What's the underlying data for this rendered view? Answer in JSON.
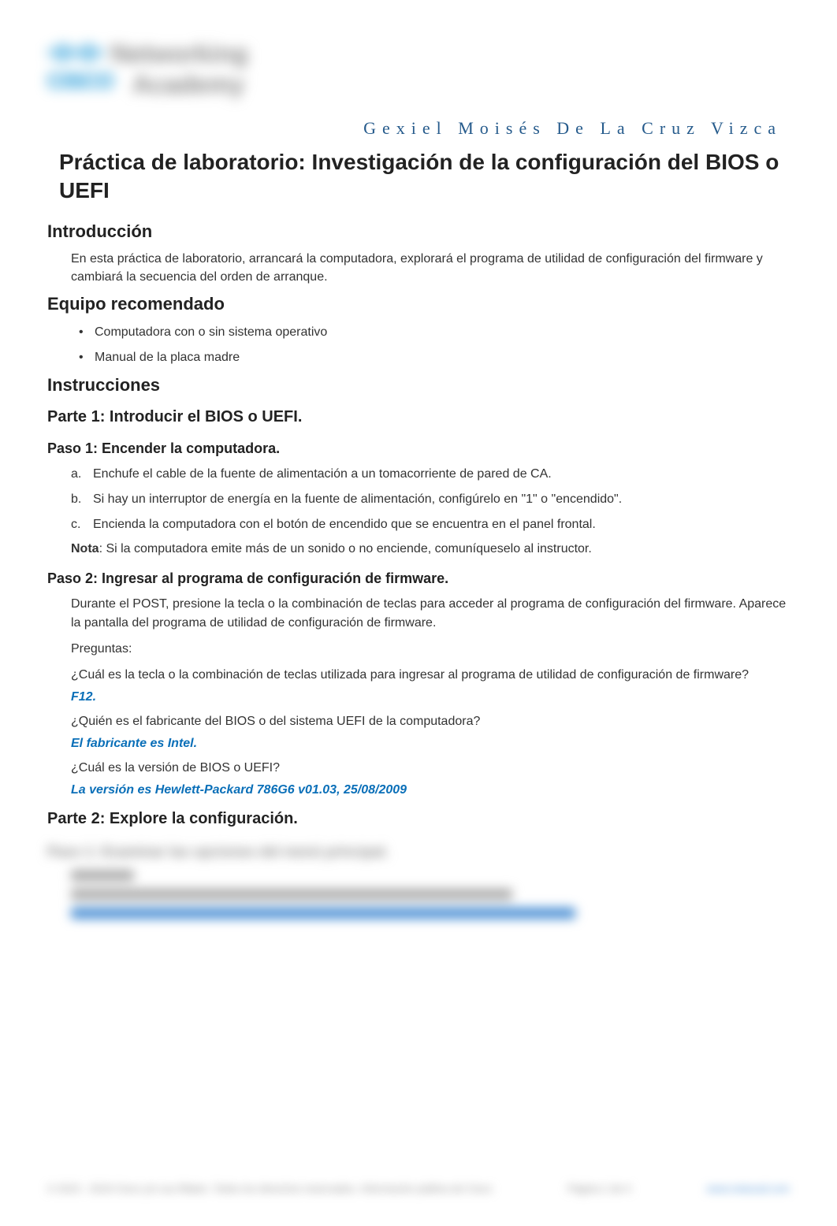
{
  "author": "Gexiel Moisés De La Cruz Vizca",
  "title": "Práctica de laboratorio: Investigación de la configuración del BIOS o UEFI",
  "intro": {
    "heading": "Introducción",
    "text": "En esta práctica de laboratorio, arrancará la computadora, explorará el programa de utilidad de configuración del firmware y cambiará la secuencia del orden de arranque."
  },
  "equipment": {
    "heading": "Equipo recomendado",
    "items": [
      "Computadora con o sin sistema operativo",
      "Manual de la placa madre"
    ]
  },
  "instructions_heading": "Instrucciones",
  "part1": {
    "heading": "Parte 1: Introducir el BIOS o UEFI.",
    "step1": {
      "heading": "Paso 1: Encender la computadora.",
      "items": [
        "Enchufe el cable de la fuente de alimentación a un tomacorriente de pared de CA.",
        "Si hay un interruptor de energía en la fuente de alimentación, configúrelo en \"1\" o \"encendido\".",
        "Encienda la computadora con el botón de encendido que se encuentra en el panel frontal."
      ],
      "note_label": "Nota",
      "note_text": ": Si la computadora emite más de un sonido o no enciende, comuníqueselo al instructor."
    },
    "step2": {
      "heading": "Paso 2: Ingresar al programa de configuración de firmware.",
      "intro": "Durante el POST, presione la tecla o la combinación de teclas para acceder al programa de configuración del firmware. Aparece la pantalla del programa de utilidad de configuración de firmware.",
      "questions_label": "Preguntas:",
      "q1": "¿Cuál es la tecla o la combinación de teclas utilizada para ingresar al programa de utilidad de configuración de firmware?",
      "a1": "F12.",
      "q2": "¿Quién es el fabricante del BIOS o del sistema UEFI de la computadora?",
      "a2": "El fabricante es Intel.",
      "q3": "¿Cuál es la versión de BIOS o UEFI?",
      "a3": "La versión es Hewlett-Packard 786G6 v01.03, 25/08/2009"
    }
  },
  "part2": {
    "heading": "Parte 2: Explore la configuración."
  },
  "list_letters": [
    "a.",
    "b.",
    "c."
  ]
}
